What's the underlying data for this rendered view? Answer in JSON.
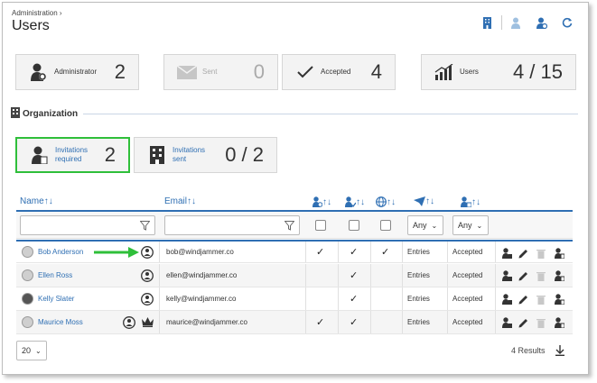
{
  "breadcrumb": "Administration",
  "page_title": "Users",
  "toolbar": {
    "icons": [
      "building-icon",
      "add-user-icon",
      "user-settings-icon",
      "refresh-icon"
    ]
  },
  "stats": [
    {
      "label": "Administrator",
      "value": "2",
      "icon": "user-gear-icon"
    },
    {
      "label": "Sent",
      "value": "0",
      "icon": "envelope-icon"
    },
    {
      "label": "Accepted",
      "value": "4",
      "icon": "checkmark-icon"
    },
    {
      "label": "Users",
      "value": "4 / 15",
      "icon": "bar-chart-icon"
    }
  ],
  "organization": {
    "title": "Organization",
    "cards": [
      {
        "label_line1": "Invitations",
        "label_line2": "required",
        "value": "2"
      },
      {
        "label_line1": "Invitations",
        "label_line2": "sent",
        "value": "0 / 2"
      }
    ]
  },
  "table": {
    "columns": {
      "name": "Name",
      "email": "Email"
    },
    "filters": {
      "any1": "Any",
      "any2": "Any"
    },
    "rows": [
      {
        "name": "Bob Anderson",
        "email": "bob@windjammer.co",
        "c1": "✓",
        "c2": "✓",
        "c3": "✓",
        "via": "Entries",
        "status": "Accepted"
      },
      {
        "name": "Ellen Ross",
        "email": "ellen@windjammer.co",
        "c1": "",
        "c2": "✓",
        "c3": "",
        "via": "Entries",
        "status": "Accepted"
      },
      {
        "name": "Kelly Slater",
        "email": "kelly@windjammer.co",
        "c1": "",
        "c2": "✓",
        "c3": "",
        "via": "Entries",
        "status": "Accepted"
      },
      {
        "name": "Maurice Moss",
        "email": "maurice@windjammer.co",
        "c1": "✓",
        "c2": "✓",
        "c3": "",
        "via": "Entries",
        "status": "Accepted"
      }
    ]
  },
  "footer": {
    "page_size": "20",
    "results": "4 Results"
  },
  "colors": {
    "accent": "#2f6fb3",
    "highlight": "#2fbf3a"
  }
}
